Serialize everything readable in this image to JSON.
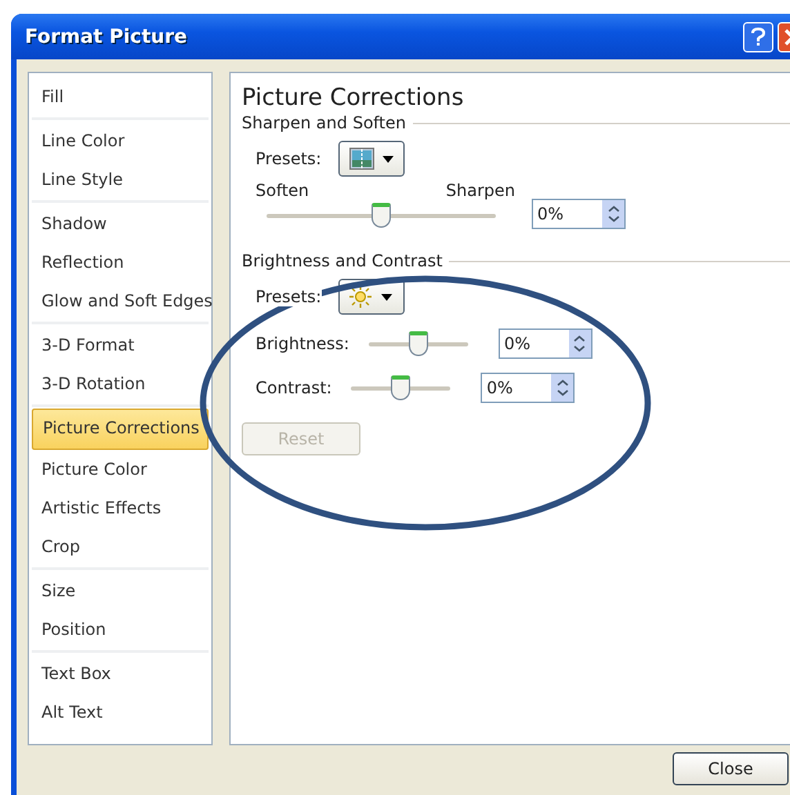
{
  "window": {
    "title": "Format Picture"
  },
  "sidebar": {
    "groups": [
      [
        {
          "label": "Fill",
          "selected": false
        }
      ],
      [
        {
          "label": "Line Color",
          "selected": false
        },
        {
          "label": "Line Style",
          "selected": false
        }
      ],
      [
        {
          "label": "Shadow",
          "selected": false
        },
        {
          "label": "Reflection",
          "selected": false
        },
        {
          "label": "Glow and Soft Edges",
          "selected": false
        }
      ],
      [
        {
          "label": "3-D Format",
          "selected": false
        },
        {
          "label": "3-D Rotation",
          "selected": false
        }
      ],
      [
        {
          "label": "Picture Corrections",
          "selected": true
        },
        {
          "label": "Picture Color",
          "selected": false
        },
        {
          "label": "Artistic Effects",
          "selected": false
        },
        {
          "label": "Crop",
          "selected": false
        }
      ],
      [
        {
          "label": "Size",
          "selected": false
        },
        {
          "label": "Position",
          "selected": false
        }
      ],
      [
        {
          "label": "Text Box",
          "selected": false
        },
        {
          "label": "Alt Text",
          "selected": false
        }
      ]
    ]
  },
  "panel": {
    "title": "Picture Corrections",
    "sharpen": {
      "heading": "Sharpen and Soften",
      "presets_label": "Presets:",
      "left_label": "Soften",
      "right_label": "Sharpen",
      "level": 0.5,
      "value": "0%"
    },
    "brightness_contrast": {
      "heading": "Brightness and Contrast",
      "presets_label": "Presets:",
      "sliders": [
        {
          "label": "Brightness:",
          "level": 0.5,
          "value": "0%"
        },
        {
          "label": "Contrast:",
          "level": 0.5,
          "value": "0%"
        }
      ],
      "reset": {
        "label": "Reset",
        "disabled": true
      }
    }
  },
  "buttons": [
    {
      "label": "Close"
    }
  ]
}
